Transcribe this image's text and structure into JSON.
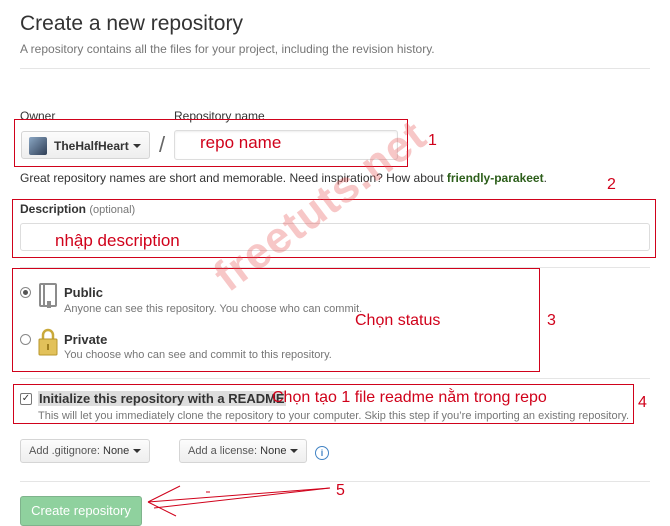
{
  "header": {
    "title": "Create a new repository",
    "subtitle": "A repository contains all the files for your project, including the revision history."
  },
  "owner": {
    "label": "Owner",
    "name": "TheHalfHeart"
  },
  "repo": {
    "label": "Repository name",
    "separator": "/",
    "value": "repo name"
  },
  "hint": {
    "text": "Great repository names are short and memorable. Need inspiration? How about ",
    "suggestion": "friendly-parakeet",
    "end": "."
  },
  "description": {
    "label": "Description",
    "optional": "(optional)",
    "value": "nhập description"
  },
  "visibility": {
    "public": {
      "title": "Public",
      "desc": "Anyone can see this repository. You choose who can commit.",
      "selected": true
    },
    "private": {
      "title": "Private",
      "desc": "You choose who can see and commit to this repository.",
      "selected": false
    }
  },
  "init": {
    "label": "Initialize this repository with a README",
    "desc": "This will let you immediately clone the repository to your computer. Skip this step if you’re importing an existing repository.",
    "checked": true
  },
  "gitignore": {
    "label": "Add .gitignore:",
    "value": "None"
  },
  "license": {
    "label": "Add a license:",
    "value": "None"
  },
  "create_button": "Create repository",
  "annotations": {
    "n1": "1",
    "n2": "2",
    "n3": "3",
    "n4": "4",
    "n5": "5",
    "status": "Chọn status",
    "readme": "Chọn tạo 1 file readme nằm trong repo"
  },
  "watermark": "freetuts.net",
  "colors": {
    "annotation": "#d0021b",
    "suggestion": "#2c5e1a",
    "create_button": "#8fd19e"
  }
}
